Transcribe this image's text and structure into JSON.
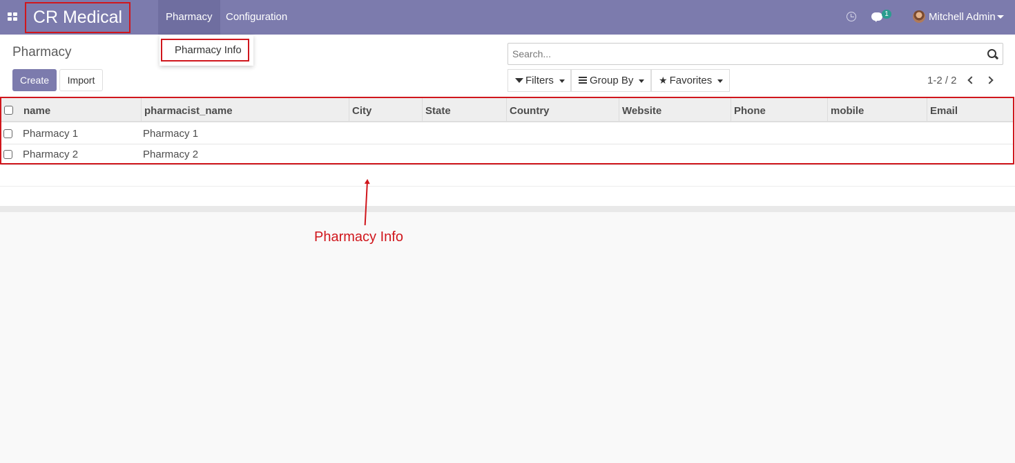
{
  "navbar": {
    "brand": "CR Medical",
    "menus": [
      "Pharmacy",
      "Configuration"
    ],
    "chat_count": "1",
    "user_name": "Mitchell Admin"
  },
  "dropdown": {
    "item": "Pharmacy Info"
  },
  "control_panel": {
    "title": "Pharmacy",
    "create_label": "Create",
    "import_label": "Import",
    "search_placeholder": "Search...",
    "filters_label": "Filters",
    "group_by_label": "Group By",
    "favorites_label": "Favorites",
    "pager": "1-2 / 2"
  },
  "table": {
    "columns": [
      "name",
      "pharmacist_name",
      "City",
      "State",
      "Country",
      "Website",
      "Phone",
      "mobile",
      "Email"
    ],
    "rows": [
      {
        "name": "Pharmacy 1",
        "pharmacist_name": "Pharmacy 1"
      },
      {
        "name": "Pharmacy 2",
        "pharmacist_name": "Pharmacy 2"
      }
    ]
  },
  "annotation": {
    "label": "Pharmacy Info"
  },
  "colors": {
    "brand": "#7c7bad",
    "highlight": "#d0161c"
  }
}
